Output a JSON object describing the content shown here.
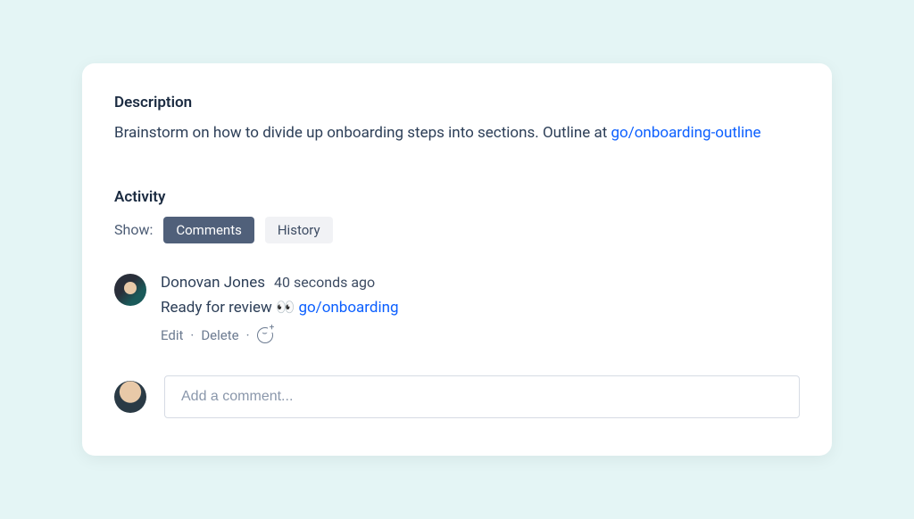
{
  "description": {
    "title": "Description",
    "text_prefix": "Brainstorm on how to divide up onboarding steps into sections. Outline at ",
    "link_text": "go/onboarding-outline"
  },
  "activity": {
    "title": "Activity",
    "show_label": "Show:",
    "tabs": {
      "comments": "Comments",
      "history": "History"
    }
  },
  "comment": {
    "author": "Donovan Jones",
    "timestamp": "40 seconds ago",
    "body_prefix": "Ready for review 👀 ",
    "body_link": "go/onboarding",
    "actions": {
      "edit": "Edit",
      "delete": "Delete"
    }
  },
  "composer": {
    "placeholder": "Add a comment..."
  }
}
